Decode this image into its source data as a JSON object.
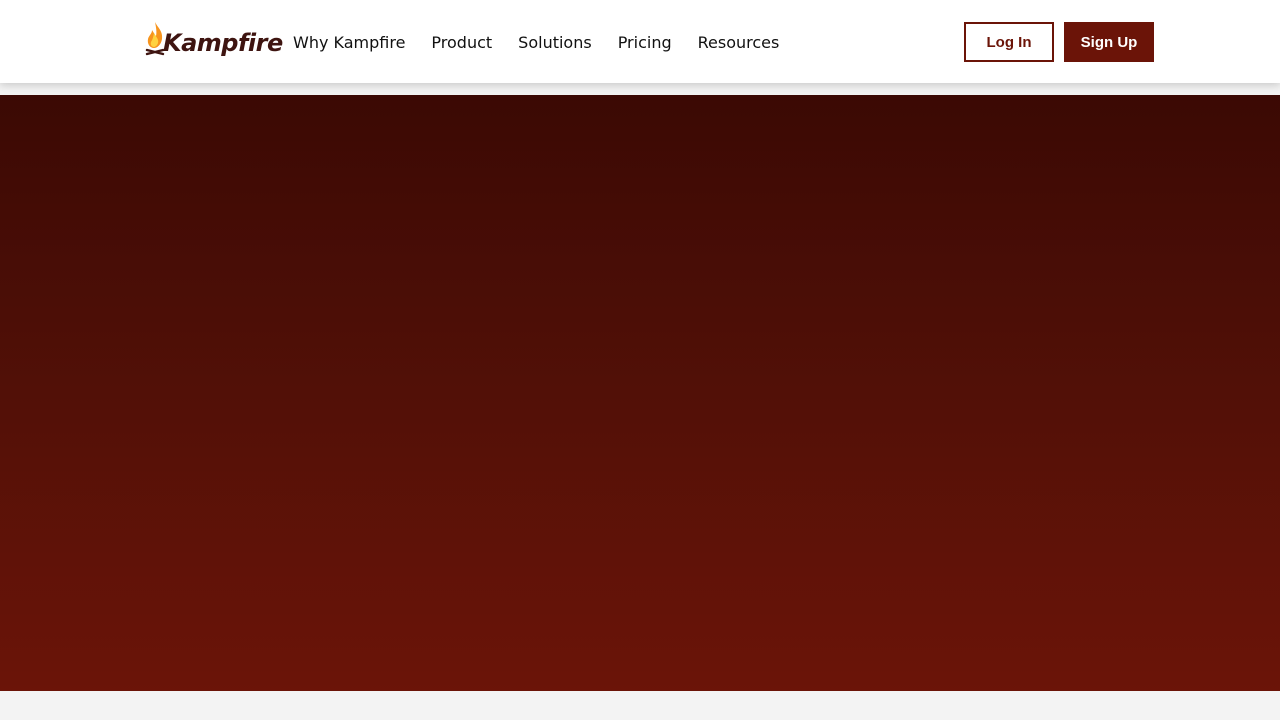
{
  "brand": {
    "name": "Kampfire",
    "logo_icon": "campfire-flame-icon",
    "flame_color": "#f7941d",
    "text_color": "#3e1410"
  },
  "nav": {
    "items": [
      {
        "label": "Why Kampfire"
      },
      {
        "label": "Product"
      },
      {
        "label": "Solutions"
      },
      {
        "label": "Pricing"
      },
      {
        "label": "Resources"
      }
    ]
  },
  "auth": {
    "login_label": "Log In",
    "signup_label": "Sign Up"
  },
  "theme": {
    "accent": "#6b1408",
    "hero_top": "#3b0904",
    "hero_bottom": "#6b1408",
    "page_bg": "#f3f3f3"
  }
}
